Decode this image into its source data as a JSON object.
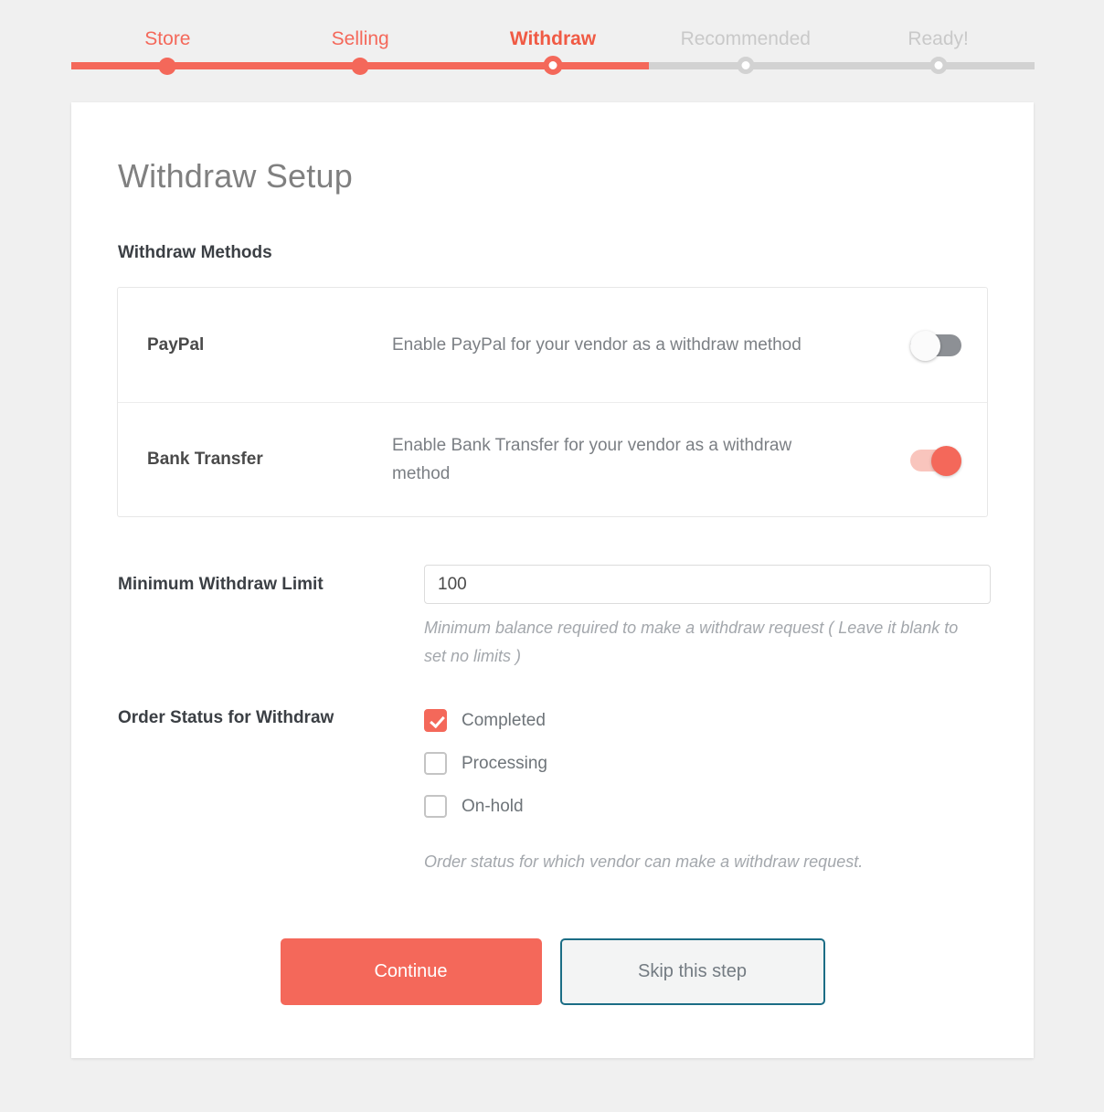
{
  "stepper": {
    "steps": [
      {
        "label": "Store",
        "state": "done"
      },
      {
        "label": "Selling",
        "state": "done"
      },
      {
        "label": "Withdraw",
        "state": "current"
      },
      {
        "label": "Recommended",
        "state": "todo"
      },
      {
        "label": "Ready!",
        "state": "todo"
      }
    ],
    "accent_color": "#f4685a",
    "inactive_color": "#d2d2d2"
  },
  "card": {
    "title": "Withdraw Setup",
    "methods_section_title": "Withdraw Methods",
    "methods": [
      {
        "name": "PayPal",
        "description": "Enable PayPal for your vendor as a withdraw method",
        "enabled": false
      },
      {
        "name": "Bank Transfer",
        "description": "Enable Bank Transfer for your vendor as a withdraw method",
        "enabled": true
      }
    ],
    "minimum_withdraw": {
      "label": "Minimum Withdraw Limit",
      "value": "100",
      "placeholder": "",
      "help": "Minimum balance required to make a withdraw request ( Leave it blank to set no limits )"
    },
    "order_status": {
      "label": "Order Status for Withdraw",
      "options": [
        {
          "label": "Completed",
          "checked": true
        },
        {
          "label": "Processing",
          "checked": false
        },
        {
          "label": "On-hold",
          "checked": false
        }
      ],
      "help": "Order status for which vendor can make a withdraw request."
    },
    "actions": {
      "primary_label": "Continue",
      "secondary_label": "Skip this step"
    }
  }
}
